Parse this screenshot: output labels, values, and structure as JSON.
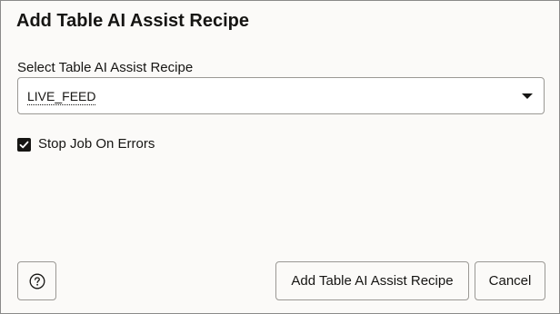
{
  "dialog": {
    "title": "Add Table AI Assist Recipe"
  },
  "recipe_select": {
    "label": "Select Table AI Assist Recipe",
    "value": "LIVE_FEED"
  },
  "stop_on_errors": {
    "label": "Stop Job On Errors",
    "checked": true
  },
  "footer": {
    "help_icon": "question-circle-icon",
    "add_label": "Add Table AI Assist Recipe",
    "cancel_label": "Cancel"
  }
}
